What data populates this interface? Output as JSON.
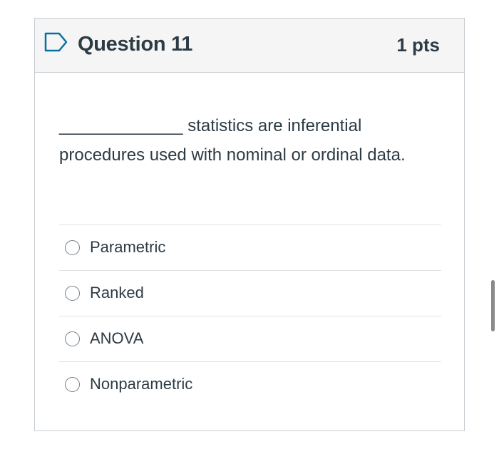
{
  "question": {
    "title": "Question 11",
    "points": "1 pts",
    "flag_icon": "flag-outline-icon",
    "text": "_____________ statistics are inferential procedures used with nominal or ordinal data."
  },
  "answers": [
    {
      "label": "Parametric",
      "selected": false
    },
    {
      "label": "Ranked",
      "selected": false
    },
    {
      "label": "ANOVA",
      "selected": false
    },
    {
      "label": "Nonparametric",
      "selected": false
    }
  ],
  "colors": {
    "header_background": "#f5f5f5",
    "border": "#c7cdd1",
    "text": "#2d3b45",
    "flag_accent": "#0770a3"
  }
}
